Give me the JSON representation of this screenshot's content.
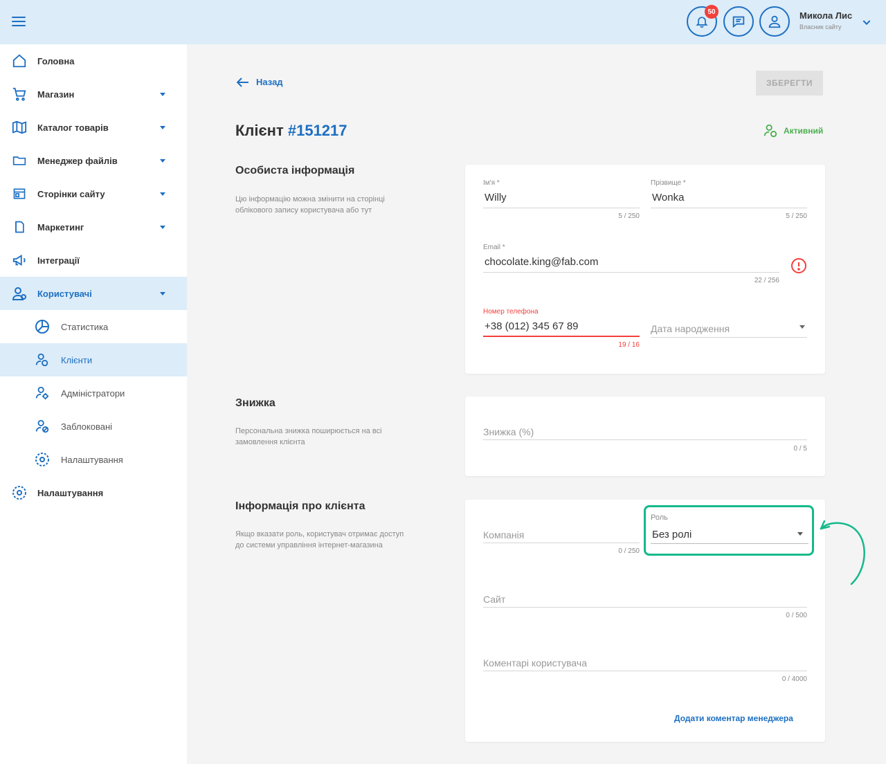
{
  "header": {
    "notifications_count": "50",
    "user_name": "Микола Лис",
    "user_role": "Власник сайту"
  },
  "sidebar": {
    "items": [
      {
        "label": "Головна",
        "icon": "home-icon"
      },
      {
        "label": "Магазин",
        "icon": "cart-icon"
      },
      {
        "label": "Каталог товарів",
        "icon": "book-icon"
      },
      {
        "label": "Менеджер файлів",
        "icon": "folder-icon"
      },
      {
        "label": "Сторінки сайту",
        "icon": "pages-icon"
      },
      {
        "label": "Маркетинг",
        "icon": "marketing-icon"
      },
      {
        "label": "Інтеграції",
        "icon": "megaphone-icon"
      },
      {
        "label": "Користувачі",
        "icon": "users-icon"
      },
      {
        "label": "Налаштування",
        "icon": "settings-icon"
      }
    ],
    "sub_items": [
      {
        "label": "Статистика",
        "icon": "stats-icon"
      },
      {
        "label": "Клієнти",
        "icon": "clients-icon"
      },
      {
        "label": "Адміністратори",
        "icon": "admins-icon"
      },
      {
        "label": "Заблоковані",
        "icon": "blocked-icon"
      },
      {
        "label": "Налаштування",
        "icon": "gear-icon"
      }
    ]
  },
  "main": {
    "back_label": "Назад",
    "save_label": "ЗБЕРЕГТИ",
    "title_prefix": "Клієнт",
    "title_number": "#151217",
    "status_label": "Активний",
    "personal": {
      "title": "Особиста інформація",
      "desc": "Цю інформацію можна змінити на сторінці облікового запису користувача або тут",
      "first_name_label": "Ім'я *",
      "first_name_value": "Willy",
      "first_name_counter": "5 / 250",
      "last_name_label": "Прізвище *",
      "last_name_value": "Wonka",
      "last_name_counter": "5 / 250",
      "email_label": "Email *",
      "email_value": "chocolate.king@fab.com",
      "email_counter": "22 / 256",
      "phone_label": "Номер телефона",
      "phone_value": "+38 (012) 345 67 89",
      "phone_counter": "19 / 16",
      "birthday_placeholder": "Дата народження"
    },
    "discount": {
      "title": "Знижка",
      "desc": "Персональна знижка поширюється на всі замовлення клієнта",
      "placeholder": "Знижка (%)",
      "counter": "0 / 5"
    },
    "client_info": {
      "title": "Інформація про клієнта",
      "desc": "Якщо вказати роль, користувач отримає доступ до системи управління інтернет-магазина",
      "company_placeholder": "Компанія",
      "company_counter": "0 / 250",
      "role_label": "Роль",
      "role_value": "Без ролі",
      "site_placeholder": "Сайт",
      "site_counter": "0 / 500",
      "comments_placeholder": "Коментарі користувача",
      "comments_counter": "0 / 4000",
      "manager_comment_link": "Додати коментар менеджера"
    }
  },
  "colors": {
    "accent": "#1d6fc2",
    "highlight": "#14b98b",
    "error": "#f3403b",
    "success": "#4caf50"
  }
}
